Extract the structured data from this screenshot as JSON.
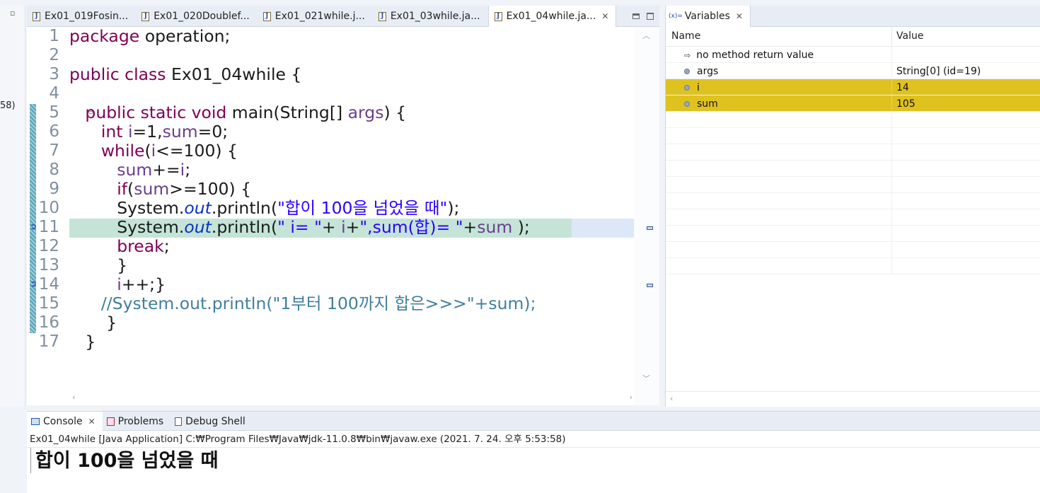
{
  "left_strip": {
    "number_fragment": "58)"
  },
  "editor_tabs": [
    {
      "label": "Ex01_019Fosin..."
    },
    {
      "label": "Ex01_020Doublef..."
    },
    {
      "label": "Ex01_021while.j..."
    },
    {
      "label": "Ex01_03while.ja..."
    },
    {
      "label": "Ex01_04while.ja...",
      "active": true
    }
  ],
  "editor": {
    "line_numbers": [
      "1",
      "2",
      "3",
      "4",
      "5",
      "6",
      "7",
      "8",
      "9",
      "10",
      "11",
      "12",
      "13",
      "14",
      "15",
      "16",
      "17"
    ],
    "current_line": 11,
    "lines": [
      "package operation;",
      "",
      "public class Ex01_04while {",
      "",
      "    public static void main(String[] args) {",
      "        int i=1,sum=0;",
      "        while(i<=100) {",
      "            sum+=i;",
      "            if(sum>=100) {",
      "            System.out.println(\"합이 100을 넘었을 때\");",
      "            System.out.println(\" i= \"+ i+\",sum(합)= \"+sum );",
      "            break;",
      "            }",
      "            i++;}",
      "        //System.out.println(\"1부터 100까지 합은>>>\"+sum);",
      "         }",
      "    }"
    ]
  },
  "variables": {
    "tab_label": "Variables",
    "col_name": "Name",
    "col_value": "Value",
    "rows": [
      {
        "name": "no method return value",
        "value": "",
        "kind": "return"
      },
      {
        "name": "args",
        "value": "String[0]  (id=19)",
        "kind": "var"
      },
      {
        "name": "i",
        "value": "14",
        "kind": "var",
        "selected": true
      },
      {
        "name": "sum",
        "value": "105",
        "kind": "var",
        "selected": true
      }
    ]
  },
  "console": {
    "tabs": [
      {
        "label": "Console",
        "active": true
      },
      {
        "label": "Problems"
      },
      {
        "label": "Debug Shell"
      }
    ],
    "info": "Ex01_04while [Java Application] C:₩Program Files₩Java₩jdk-11.0.8₩bin₩javaw.exe  (2021. 7. 24. 오후 5:53:58)",
    "output": "합이 100을 넘었을 때"
  },
  "colors": {
    "selection": "#dfc220",
    "debug_line": "#c4e4d8",
    "current_line": "#dce8f8"
  }
}
